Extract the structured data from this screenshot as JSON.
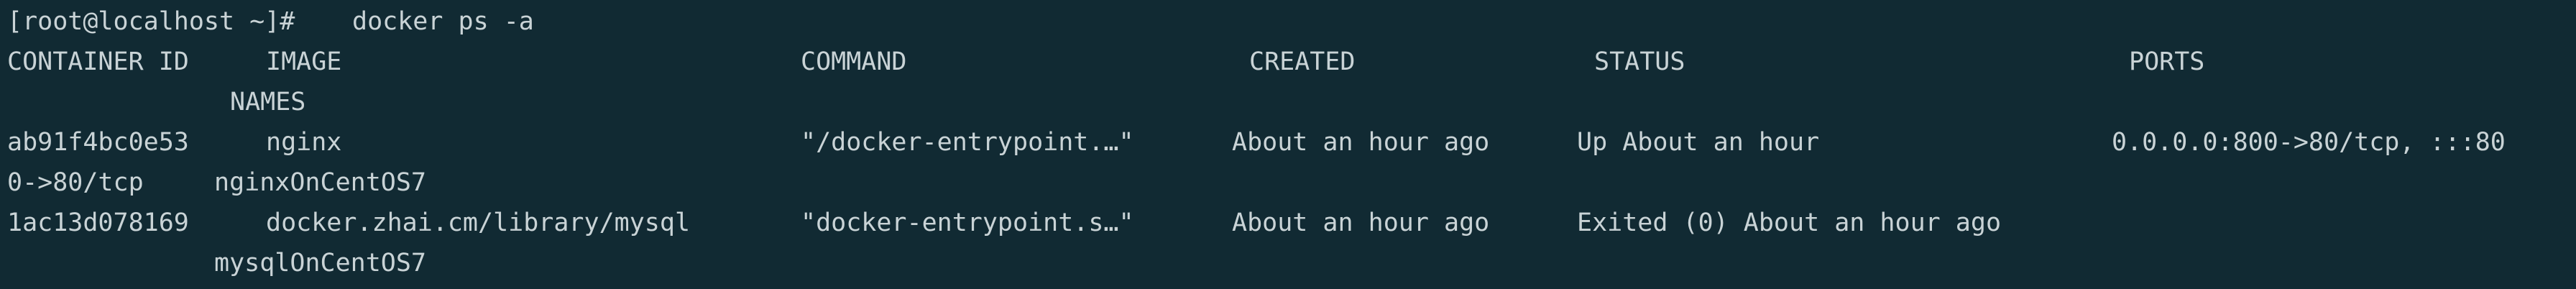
{
  "terminal": {
    "prompt": "[root@localhost ~]# ",
    "command": "docker ps -a"
  },
  "table": {
    "headers": {
      "container_id": "CONTAINER ID",
      "image": "IMAGE",
      "command": "COMMAND",
      "created": "CREATED",
      "status": "STATUS",
      "ports": "PORTS",
      "names": "NAMES"
    },
    "rows": [
      {
        "container_id": "ab91f4bc0e53",
        "image": "nginx",
        "command": "\"/docker-entrypoint.…\"",
        "created": "About an hour ago",
        "status": "Up About an hour",
        "ports_line1": "0.0.0.0:800->80/tcp, :::80",
        "ports_line2": "0->80/tcp",
        "name": "nginxOnCentOS7"
      },
      {
        "container_id": "1ac13d078169",
        "image": "docker.zhai.cm/library/mysql",
        "command": "\"docker-entrypoint.s…\"",
        "created": "About an hour ago",
        "status": "Exited (0) About an hour ago",
        "name": "mysqlOnCentOS7"
      }
    ]
  }
}
